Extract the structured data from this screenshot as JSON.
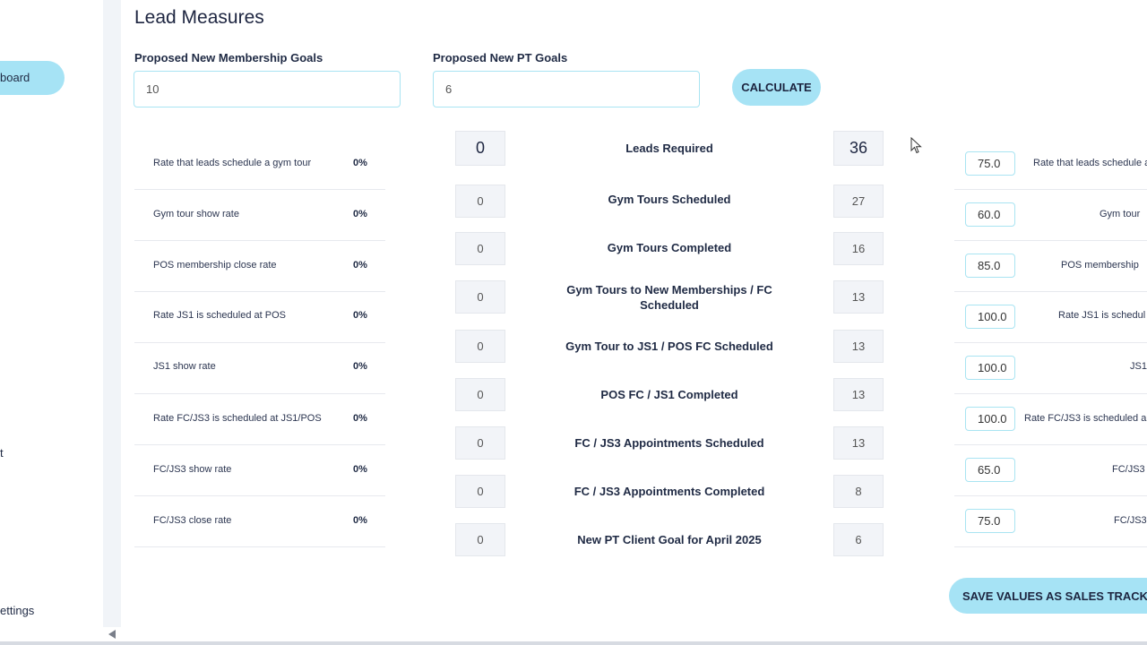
{
  "sidebar": {
    "active_item": "board",
    "item_t": "t",
    "item_settings": "ettings"
  },
  "page": {
    "title": "Lead Measures"
  },
  "membership_goal": {
    "label": "Proposed New Membership Goals",
    "value": "10"
  },
  "pt_goal": {
    "label": "Proposed New PT Goals",
    "value": "6"
  },
  "calculate_label": "CALCULATE",
  "save_label": "SAVE VALUES AS SALES TRACKER",
  "rates": [
    {
      "label": "Rate that leads schedule a gym tour",
      "pct": "0%"
    },
    {
      "label": "Gym tour show rate",
      "pct": "0%"
    },
    {
      "label": "POS membership close rate",
      "pct": "0%"
    },
    {
      "label": "Rate JS1 is scheduled at POS",
      "pct": "0%"
    },
    {
      "label": "JS1 show rate",
      "pct": "0%"
    },
    {
      "label": "Rate FC/JS3 is scheduled at JS1/POS",
      "pct": "0%"
    },
    {
      "label": "FC/JS3 show rate",
      "pct": "0%"
    },
    {
      "label": "FC/JS3 close rate",
      "pct": "0%"
    }
  ],
  "metrics": [
    {
      "label": "Leads Required",
      "actual": "0",
      "target": "36"
    },
    {
      "label": "Gym Tours Scheduled",
      "actual": "0",
      "target": "27"
    },
    {
      "label": "Gym Tours Completed",
      "actual": "0",
      "target": "16"
    },
    {
      "label": "Gym Tours to New Memberships / FC Scheduled",
      "actual": "0",
      "target": "13"
    },
    {
      "label": "Gym Tour to JS1 / POS FC Scheduled",
      "actual": "0",
      "target": "13"
    },
    {
      "label": "POS FC / JS1 Completed",
      "actual": "0",
      "target": "13"
    },
    {
      "label": "FC / JS3 Appointments Scheduled",
      "actual": "0",
      "target": "13"
    },
    {
      "label": "FC / JS3 Appointments Completed",
      "actual": "0",
      "target": "8"
    },
    {
      "label": "New PT Client Goal for April 2025",
      "actual": "0",
      "target": "6"
    }
  ],
  "target_rates": [
    {
      "value": "75.0",
      "label": "Rate that leads schedule a"
    },
    {
      "value": "60.0",
      "label": "Gym tour"
    },
    {
      "value": "85.0",
      "label": "POS membership"
    },
    {
      "value": "100.0",
      "label": "Rate JS1 is schedul"
    },
    {
      "value": "100.0",
      "label": "JS1"
    },
    {
      "value": "100.0",
      "label": "Rate FC/JS3 is scheduled a"
    },
    {
      "value": "65.0",
      "label": "FC/JS3"
    },
    {
      "value": "75.0",
      "label": "FC/JS3"
    }
  ]
}
